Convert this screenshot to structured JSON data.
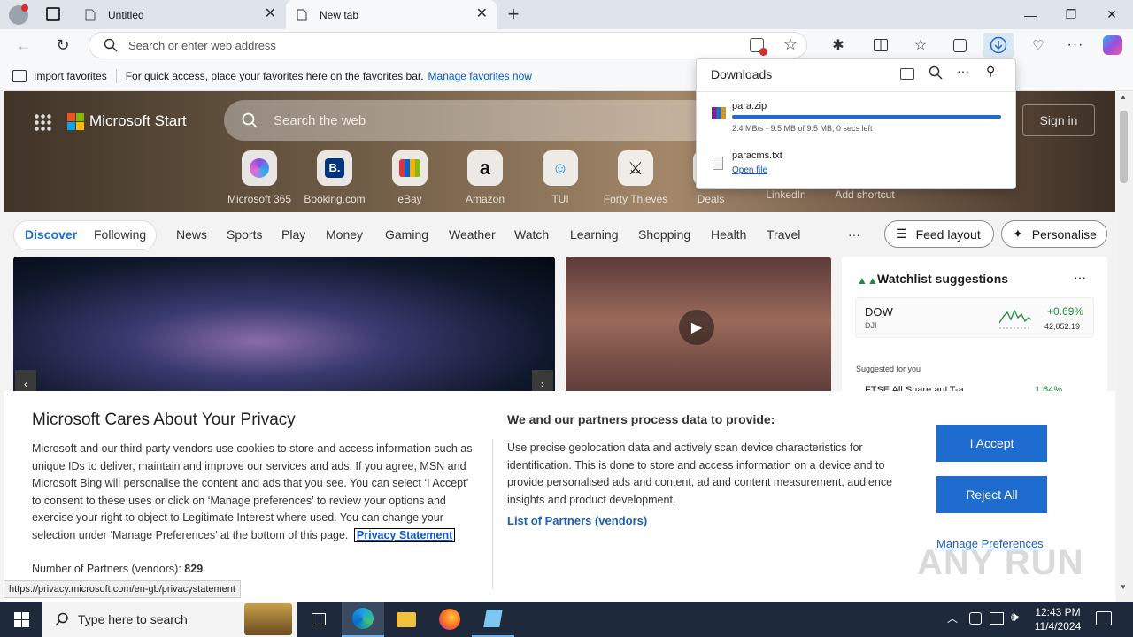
{
  "tabs": [
    {
      "title": "Untitled"
    },
    {
      "title": "New tab"
    }
  ],
  "address": {
    "placeholder": "Search or enter web address"
  },
  "favbar": {
    "import_label": "Import favorites",
    "hint": "For quick access, place your favorites here on the favorites bar.",
    "manage_link": "Manage favorites now"
  },
  "msstart": {
    "brand": "Microsoft Start",
    "search_placeholder": "Search the web",
    "signin": "Sign in",
    "shortcuts": [
      "Microsoft 365",
      "Booking.com",
      "eBay",
      "Amazon",
      "TUI",
      "Forty Thieves",
      "Deals",
      "LinkedIn",
      "Add shortcut"
    ],
    "tabs": [
      "Discover",
      "Following",
      "News",
      "Sports",
      "Play",
      "Money",
      "Gaming",
      "Weather",
      "Watch",
      "Learning",
      "Shopping",
      "Health",
      "Travel"
    ],
    "more": "···",
    "feed_layout": "Feed layout",
    "personalise": "Personalise"
  },
  "watchlist": {
    "title": "Watchlist suggestions",
    "more": "···",
    "item_name": "DOW",
    "item_ticker": "DJI",
    "item_change": "+0.69%",
    "item_value": "42,052.19",
    "suggested": "Suggested for you",
    "next_item": "FTSE All Share auLT-a",
    "next_change": "1.64%"
  },
  "downloads": {
    "title": "Downloads",
    "items": [
      {
        "name": "para.zip",
        "status": "2.4 MB/s - 9.5 MB of 9.5 MB, 0 secs left",
        "progress": 1.0
      },
      {
        "name": "paracms.txt",
        "action": "Open file"
      }
    ]
  },
  "privacy": {
    "heading": "Microsoft Cares About Your Privacy",
    "body": "Microsoft and our third-party vendors use cookies to store and access information such as unique IDs to deliver, maintain and improve our services and ads. If you agree, MSN and Microsoft Bing will personalise the content and ads that you see. You can select ‘I Accept’ to consent to these uses or click on ‘Manage preferences’ to review your options and exercise your right to object to Legitimate Interest where used. You can change your selection under ‘Manage Preferences’ at the bottom of this page.",
    "privacy_link": "Privacy Statement",
    "partners_label": "Number of Partners (vendors):",
    "partners_count": "829",
    "right_heading": "We and our partners process data to provide:",
    "right_body": "Use precise geolocation data and actively scan device characteristics for identification. This is done to store and access information on a device and to provide personalised ads and content, ad and content measurement, audience insights and product development.",
    "partners_link": "List of Partners (vendors)",
    "accept": "I Accept",
    "reject": "Reject All",
    "manage": "Manage Preferences"
  },
  "statusbar": {
    "url": "https://privacy.microsoft.com/en-gb/privacystatement"
  },
  "watermark": "ANY RUN",
  "taskbar": {
    "search_placeholder": "Type here to search",
    "time": "12:43 PM",
    "date": "11/4/2024"
  },
  "colors": {
    "accent": "#1e6ccf",
    "link": "#0b57d0",
    "taskbar": "#1e2a3c"
  }
}
